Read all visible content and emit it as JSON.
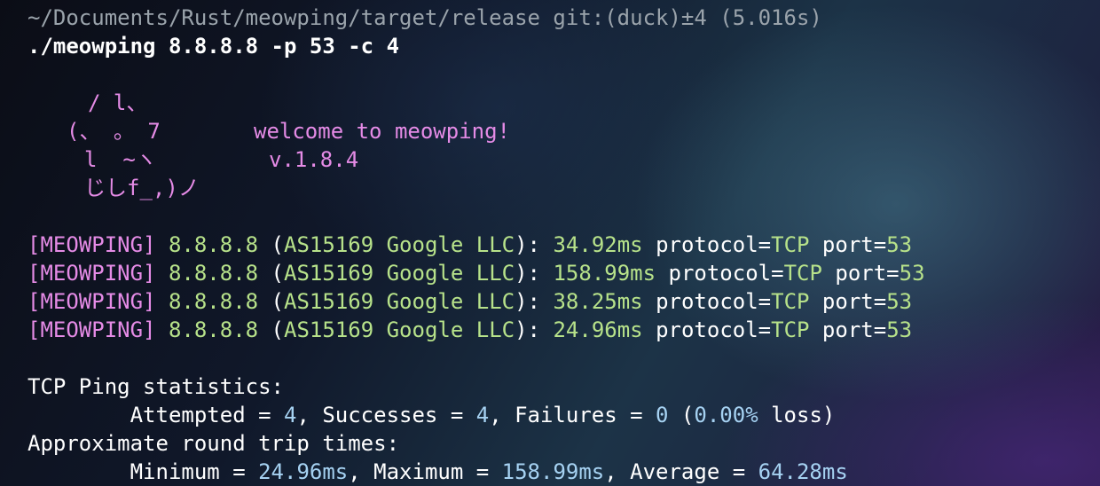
{
  "prompt": {
    "path_line": "~/Documents/Rust/meowping/target/release git:(duck)±4 (5.016s)",
    "command": "./meowping 8.8.8.8 -p 53 -c 4"
  },
  "banner": {
    "art_line1": "/ l、",
    "art_line2": "(、 。 7",
    "art_line3": "l  ~ヽ",
    "art_line4": "じしf_,)ノ",
    "welcome": "welcome to meowping!",
    "version": "v.1.8.4"
  },
  "results": [
    {
      "tag": "[MEOWPING]",
      "ip": "8.8.8.8",
      "open": " (",
      "asn": "AS15169 Google LLC",
      "close": "): ",
      "latency": "34.92ms",
      "proto_key": " protocol=",
      "proto_val": "TCP",
      "port_key": " port=",
      "port_val": "53"
    },
    {
      "tag": "[MEOWPING]",
      "ip": "8.8.8.8",
      "open": " (",
      "asn": "AS15169 Google LLC",
      "close": "): ",
      "latency": "158.99ms",
      "proto_key": " protocol=",
      "proto_val": "TCP",
      "port_key": " port=",
      "port_val": "53"
    },
    {
      "tag": "[MEOWPING]",
      "ip": "8.8.8.8",
      "open": " (",
      "asn": "AS15169 Google LLC",
      "close": "): ",
      "latency": "38.25ms",
      "proto_key": " protocol=",
      "proto_val": "TCP",
      "port_key": " port=",
      "port_val": "53"
    },
    {
      "tag": "[MEOWPING]",
      "ip": "8.8.8.8",
      "open": " (",
      "asn": "AS15169 Google LLC",
      "close": "): ",
      "latency": "24.96ms",
      "proto_key": " protocol=",
      "proto_val": "TCP",
      "port_key": " port=",
      "port_val": "53"
    }
  ],
  "stats": {
    "heading": "TCP Ping statistics:",
    "attempted_label": "        Attempted = ",
    "attempted": "4",
    "successes_label": ", Successes = ",
    "successes": "4",
    "failures_label": ", Failures = ",
    "failures": "0",
    "loss_open": " (",
    "loss_pct": "0.00%",
    "loss_close": " loss)",
    "rtt_heading": "Approximate round trip times:",
    "min_label": "        Minimum = ",
    "min": "24.96ms",
    "max_label": ", Maximum = ",
    "max": "158.99ms",
    "avg_label": ", Average = ",
    "avg": "64.28ms"
  },
  "colors": {
    "tag": "#e58be6",
    "green": "#b7e28a",
    "number": "#a6d2f2",
    "dim": "#9aa3ab"
  }
}
